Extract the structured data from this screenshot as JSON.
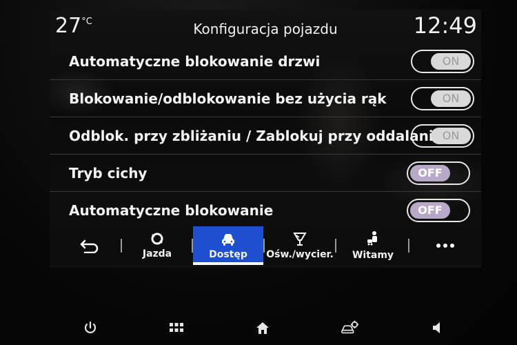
{
  "status": {
    "temperature": "27",
    "temperature_unit": "°C",
    "title": "Konfiguracja pojazdu",
    "time": "12:49"
  },
  "settings": [
    {
      "label": "Automatyczne blokowanie drzwi",
      "state": "ON"
    },
    {
      "label": "Blokowanie/odblokowanie bez użycia rąk",
      "state": "ON"
    },
    {
      "label": "Odblok. przy zbliżaniu / Zablokuj przy oddalaniu",
      "state": "ON"
    },
    {
      "label": "Tryb cichy",
      "state": "OFF"
    },
    {
      "label": "Automatyczne blokowanie",
      "state": "OFF"
    }
  ],
  "tabs": [
    {
      "label": "Jazda",
      "icon": "steering-loop-icon"
    },
    {
      "label": "Dostęp",
      "icon": "car-access-icon",
      "active": true
    },
    {
      "label": "Ośw./wycier.",
      "icon": "light-wiper-icon"
    },
    {
      "label": "Witamy",
      "icon": "welcome-person-icon"
    }
  ],
  "colors": {
    "active_tab": "#1f4fd1",
    "toggle_off_knob": "#b9a9c8",
    "toggle_on_knob": "#d9d9d9"
  }
}
